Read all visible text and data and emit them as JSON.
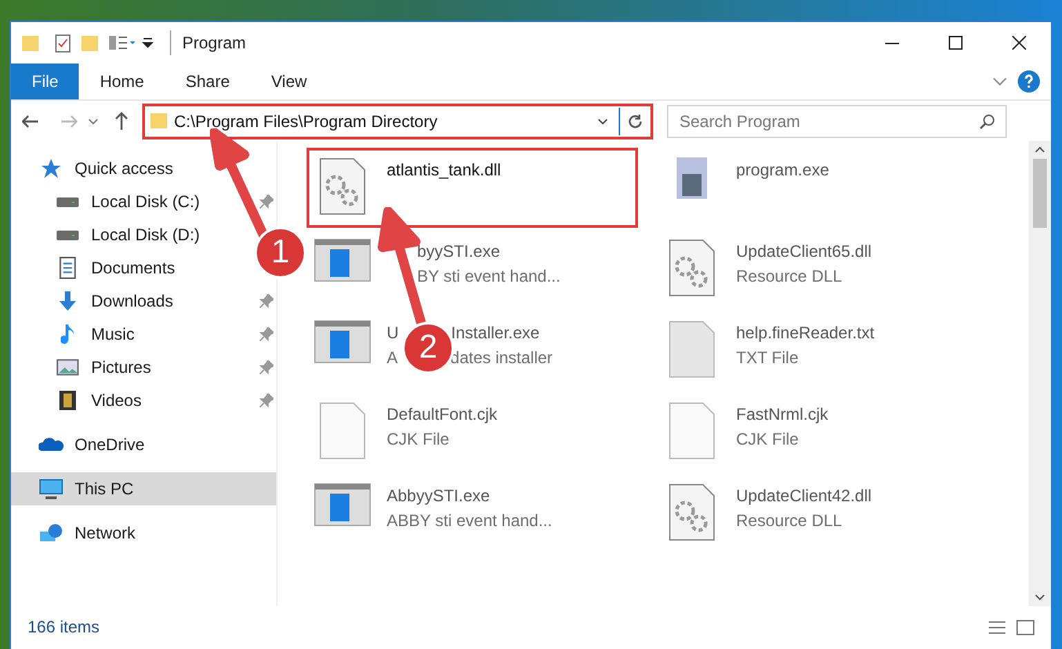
{
  "window": {
    "title": "Program"
  },
  "ribbon_tabs": [
    {
      "label": "File",
      "selected": true
    },
    {
      "label": "Home",
      "selected": false
    },
    {
      "label": "Share",
      "selected": false
    },
    {
      "label": "View",
      "selected": false
    }
  ],
  "address": {
    "path": "C:\\Program Files\\Program Directory"
  },
  "search": {
    "placeholder": "Search Program"
  },
  "sidebar": {
    "items": [
      {
        "label": "Quick access",
        "kind": "star",
        "selected": false,
        "children": [
          {
            "label": "Local Disk (C:)",
            "kind": "disk",
            "pinned": true,
            "selected": false
          },
          {
            "label": "Local Disk (D:)",
            "kind": "disk",
            "pinned": false,
            "selected": false
          },
          {
            "label": "Documents",
            "kind": "docs",
            "pinned": false,
            "selected": false
          },
          {
            "label": "Downloads",
            "kind": "download",
            "pinned": true,
            "selected": false
          },
          {
            "label": "Music",
            "kind": "music",
            "pinned": true,
            "selected": false
          },
          {
            "label": "Pictures",
            "kind": "pictures",
            "pinned": true,
            "selected": false
          },
          {
            "label": "Videos",
            "kind": "videos",
            "pinned": true,
            "selected": false
          }
        ]
      },
      {
        "label": "OneDrive",
        "kind": "cloud",
        "selected": false
      },
      {
        "label": "This PC",
        "kind": "pc",
        "selected": true
      },
      {
        "label": "Network",
        "kind": "network",
        "selected": false
      }
    ]
  },
  "files": [
    {
      "name": [
        "atlantis_tank.dll"
      ],
      "kind": "dll"
    },
    {
      "name": [
        "program.exe"
      ],
      "kind": "exe"
    },
    {
      "name": [
        "byySTI.exe"
      ],
      "type": [
        "BY sti event hand..."
      ],
      "kind": "app",
      "indented": true
    },
    {
      "name": [
        "UpdateClient65.dll"
      ],
      "type": [
        "Resource DLL"
      ],
      "kind": "dll"
    },
    {
      "name": [
        "U",
        "Installer.exe"
      ],
      "type": [
        "A",
        "dates installer"
      ],
      "kind": "app"
    },
    {
      "name": [
        "help.fineReader.txt"
      ],
      "type": [
        "TXT File"
      ],
      "kind": "txt"
    },
    {
      "name": [
        "DefaultFont.cjk"
      ],
      "type": [
        "CJK File"
      ],
      "kind": "blank"
    },
    {
      "name": [
        "FastNrml.cjk"
      ],
      "type": [
        "CJK File"
      ],
      "kind": "blank"
    },
    {
      "name": [
        "AbbyySTI.exe"
      ],
      "type": [
        "ABBY sti event hand..."
      ],
      "kind": "app"
    },
    {
      "name": [
        "UpdateClient42.dll"
      ],
      "type": [
        "Resource DLL"
      ],
      "kind": "dll"
    }
  ],
  "status_bar": {
    "count": "166 items"
  },
  "callouts": [
    {
      "number": "1"
    },
    {
      "number": "2"
    }
  ]
}
